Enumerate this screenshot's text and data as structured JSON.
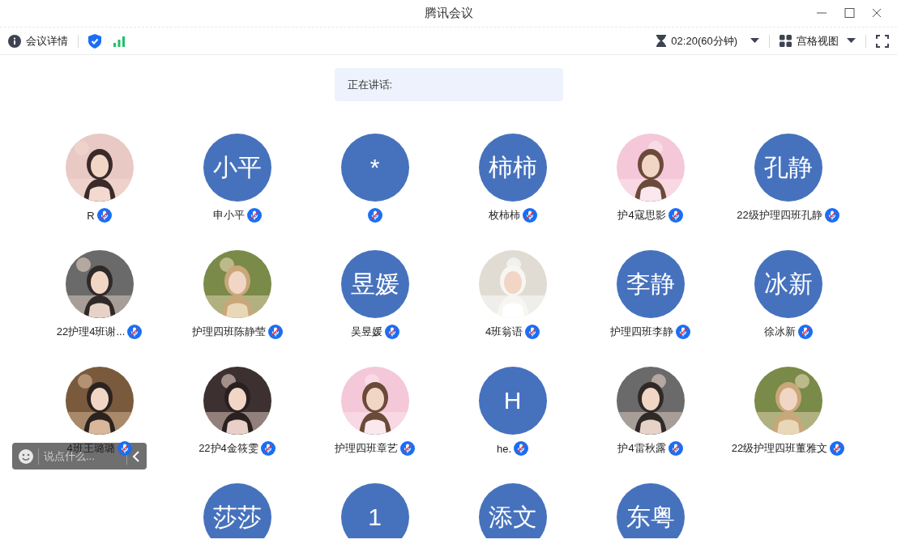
{
  "window": {
    "title": "腾讯会议"
  },
  "toolbar": {
    "details_label": "会议详情",
    "timer": "02:20(60分钟)",
    "view_label": "宫格视图"
  },
  "speaking": {
    "label": "正在讲话:"
  },
  "participants": [
    {
      "name": "R",
      "muted": true
    },
    {
      "name": "申小平",
      "avatar": {
        "kind": "initials",
        "text": "小平"
      },
      "muted": true
    },
    {
      "avatar": {
        "kind": "initials",
        "text": "*"
      },
      "muted": true
    },
    {
      "name": "枚柿柿",
      "avatar": {
        "kind": "initials",
        "text": "柿柿"
      },
      "muted": true
    },
    {
      "name": "护4寇思影",
      "muted": true
    },
    {
      "name": "22级护理四班孔静",
      "avatar": {
        "kind": "initials",
        "text": "孔静"
      },
      "muted": true
    },
    {
      "name": "22护理4班谢...",
      "muted": true
    },
    {
      "name": "护理四班陈静莹",
      "muted": true
    },
    {
      "name": "吴昱媛",
      "avatar": {
        "kind": "initials",
        "text": "昱媛"
      },
      "muted": true
    },
    {
      "name": "4班翁语",
      "muted": true
    },
    {
      "name": "护理四班李静",
      "avatar": {
        "kind": "initials",
        "text": "李静"
      },
      "muted": true
    },
    {
      "name": "徐冰新",
      "avatar": {
        "kind": "initials",
        "text": "冰新"
      },
      "muted": true
    },
    {
      "name": "4班王璐璐",
      "muted": true
    },
    {
      "name": "22护4金筱雯",
      "muted": true
    },
    {
      "name": "护理四班章艺",
      "muted": true
    },
    {
      "name": "he.",
      "avatar": {
        "kind": "initials",
        "text": "H"
      },
      "muted": true
    },
    {
      "name": "护4雷秋露",
      "muted": true
    },
    {
      "name": "22级护理四班董雅文",
      "muted": true
    },
    {
      "avatar": {
        "kind": "initials",
        "text": "莎莎"
      }
    },
    {
      "avatar": {
        "kind": "initials",
        "text": "1"
      }
    },
    {
      "avatar": {
        "kind": "initials",
        "text": "添文"
      }
    },
    {
      "avatar": {
        "kind": "initials",
        "text": "东粤"
      }
    }
  ],
  "chat": {
    "placeholder": "说点什么..."
  }
}
